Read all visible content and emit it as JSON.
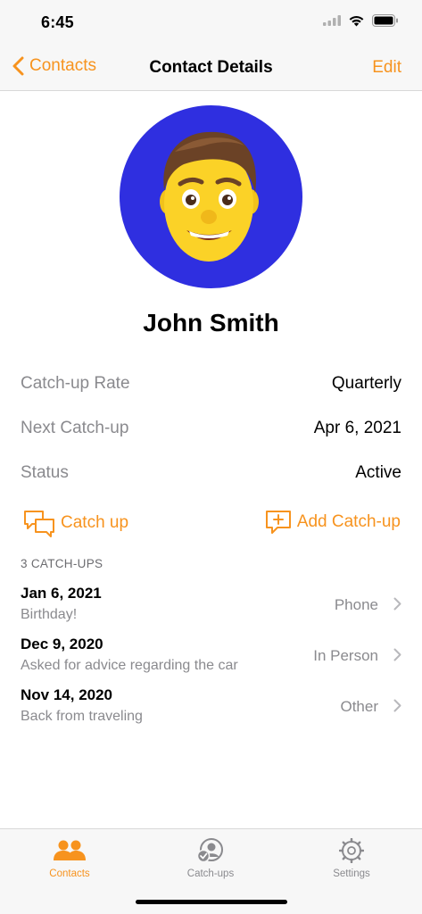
{
  "status_bar": {
    "time": "6:45"
  },
  "nav": {
    "back_label": "Contacts",
    "title": "Contact Details",
    "edit_label": "Edit"
  },
  "contact": {
    "name": "John Smith",
    "avatar_bg": "#2f2fe0"
  },
  "info": [
    {
      "label": "Catch-up Rate",
      "value": "Quarterly"
    },
    {
      "label": "Next Catch-up",
      "value": "Apr 6, 2021"
    },
    {
      "label": "Status",
      "value": "Active"
    }
  ],
  "actions": {
    "catch_up": "Catch up",
    "add_catch_up": "Add Catch-up"
  },
  "catchups": {
    "header": "3 CATCH-UPS",
    "items": [
      {
        "date": "Jan 6, 2021",
        "note": "Birthday!",
        "type": "Phone"
      },
      {
        "date": "Dec 9, 2020",
        "note": "Asked for advice regarding the car",
        "type": "In Person"
      },
      {
        "date": "Nov 14, 2020",
        "note": "Back from traveling",
        "type": "Other"
      }
    ]
  },
  "tabs": [
    {
      "label": "Contacts",
      "icon": "people-icon",
      "active": true
    },
    {
      "label": "Catch-ups",
      "icon": "person-check-icon",
      "active": false
    },
    {
      "label": "Settings",
      "icon": "gear-icon",
      "active": false
    }
  ],
  "colors": {
    "accent": "#f7931e",
    "secondary_text": "#8a8a8e"
  }
}
